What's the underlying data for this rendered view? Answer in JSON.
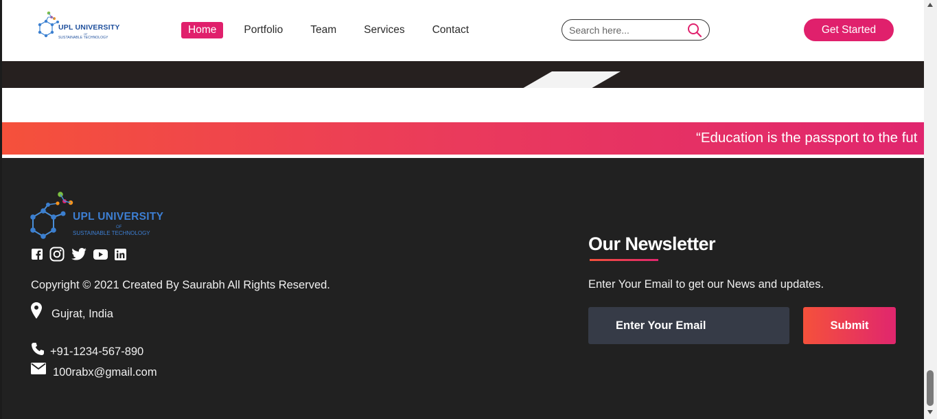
{
  "header": {
    "logo": {
      "name": "UPL UNIVERSITY",
      "of": "OF",
      "subtitle": "SUSTAINABLE TECHNOLOGY"
    },
    "nav": [
      {
        "label": "Home",
        "active": true
      },
      {
        "label": "Portfolio",
        "active": false
      },
      {
        "label": "Team",
        "active": false
      },
      {
        "label": "Services",
        "active": false
      },
      {
        "label": "Contact",
        "active": false
      }
    ],
    "search": {
      "placeholder": "Search here..."
    },
    "cta_label": "Get Started"
  },
  "banner": {
    "quote": "“Education is the passport to the fut"
  },
  "footer": {
    "logo": {
      "name": "UPL UNIVERSITY",
      "of": "OF",
      "subtitle": "SUSTAINABLE TECHNOLOGY"
    },
    "social_icons": [
      "facebook-icon",
      "instagram-icon",
      "twitter-icon",
      "youtube-icon",
      "linkedin-icon"
    ],
    "copyright": "Copyright © 2021 Created By Saurabh All Rights Reserved.",
    "location": "Gujrat, India",
    "phone": "+91-1234-567-890",
    "email": "100rabx@gmail.com",
    "newsletter": {
      "title": "Our Newsletter",
      "description": "Enter Your Email to get our News and updates.",
      "email_placeholder": "Enter Your Email",
      "submit_label": "Submit"
    }
  },
  "colors": {
    "accent": "#e0206c",
    "gradient_start": "#f5513b",
    "gradient_end": "#e0266e",
    "footer_bg": "#212121",
    "input_bg": "#363b47"
  }
}
